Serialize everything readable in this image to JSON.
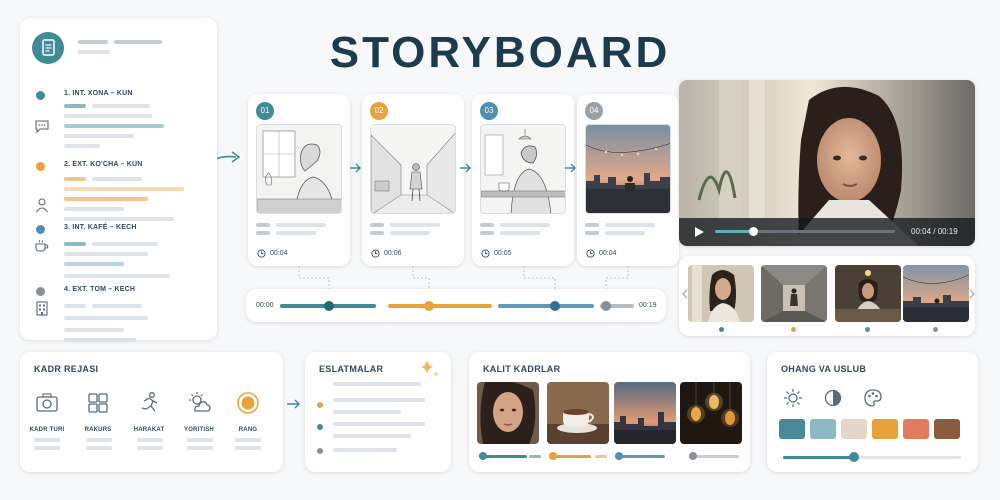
{
  "title": "STORYBOARD",
  "scenes": [
    {
      "label": "1. INT. XONA – KUN",
      "color": "#3f8b96",
      "icon": "chat-bubble-icon"
    },
    {
      "label": "2. EXT. KO'CHA – KUN",
      "color": "#e8a23c",
      "icon": "person-icon"
    },
    {
      "label": "3. INT. KAFÉ – KECH",
      "color": "#4f8fb0",
      "icon": "coffee-cup-icon"
    },
    {
      "label": "4. EXT. TOM – KECH",
      "color": "#8a9095",
      "icon": "building-icon"
    }
  ],
  "frames": [
    {
      "number": "01",
      "duration": "00:04",
      "color": "#3f8b96"
    },
    {
      "number": "02",
      "duration": "00:06",
      "color": "#e8a23c"
    },
    {
      "number": "03",
      "duration": "00:05",
      "color": "#4f8fb0"
    },
    {
      "number": "04",
      "duration": "00:04",
      "color": "#9aa0a5"
    }
  ],
  "timeline": {
    "start": "00:00",
    "end": "00:19",
    "colors": {
      "teal": "#3f8b96",
      "orange": "#e8a23c",
      "blue": "#5f9bb8",
      "grey": "#8a9095"
    }
  },
  "player": {
    "time": "00:04 / 00:19",
    "progress": 0.21
  },
  "kadr": {
    "title": "KADR REJASI",
    "items": [
      {
        "label": "KADR TURI",
        "icon": "camera-icon"
      },
      {
        "label": "RAKURS",
        "icon": "grid-icon"
      },
      {
        "label": "HARAKAT",
        "icon": "running-person-icon"
      },
      {
        "label": "YORITISH",
        "icon": "sun-cloud-icon"
      },
      {
        "label": "RANG",
        "icon": "color-circle-icon"
      }
    ]
  },
  "notes": {
    "title": "ESLATMALAR"
  },
  "keyframes": {
    "title": "KALIT  KADRLAR"
  },
  "style": {
    "title": "OHANG VA USLUB",
    "swatches": [
      "#4a8a96",
      "#8cbac2",
      "#e4d6c8",
      "#e8a23c",
      "#e07b60",
      "#8a5a3c"
    ],
    "slider": 0.4
  }
}
